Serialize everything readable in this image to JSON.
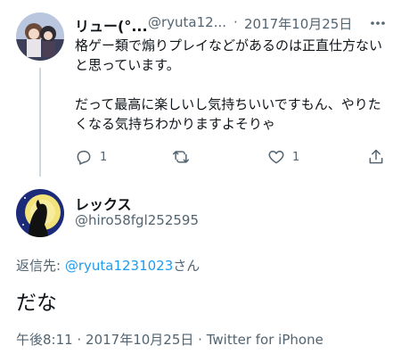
{
  "parent_tweet": {
    "display_name": "リュー(°...",
    "handle": "@ryuta12...",
    "separator": "·",
    "date": "2017年10月25日",
    "text": "格ゲー類で煽りプレイなどがあるのは正直仕方ないと思っています。\n\nだって最高に楽しいし気持ちいいですもん、やりたくなる気持ちわかりますよそりゃ",
    "reply_count": "1",
    "like_count": "1"
  },
  "main_tweet": {
    "display_name": "レックス",
    "handle": "@hiro58fgl252595",
    "reply_to_label": "返信先: ",
    "reply_to_handle": "@ryuta1231023",
    "reply_to_suffix": "さん",
    "text": "だな",
    "time": "午後8:11",
    "separator": "·",
    "date": "2017年10月25日",
    "separator2": "·",
    "source": "Twitter for iPhone"
  },
  "icons": {
    "reply": "reply-icon",
    "retweet": "retweet-icon",
    "like": "heart-icon",
    "share": "share-icon",
    "more": "more-icon"
  },
  "colors": {
    "link": "#1d9bf0",
    "secondary": "#536471",
    "line": "#cfd9de"
  }
}
